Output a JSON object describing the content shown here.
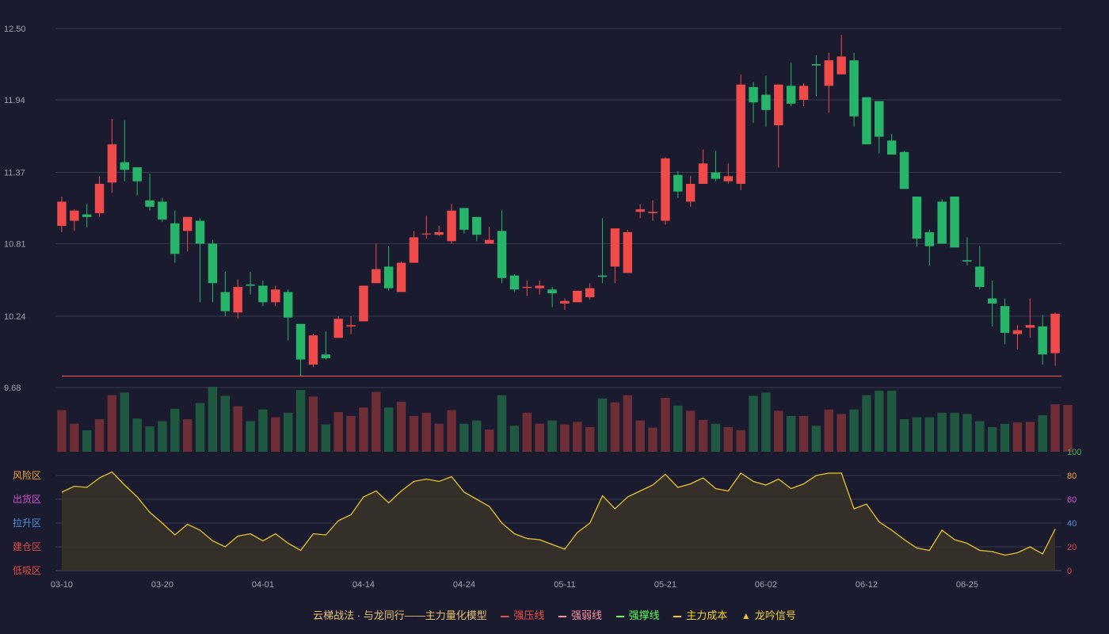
{
  "chart_data": {
    "type": "candlestick",
    "price_axis": {
      "ticks": [
        "12.50",
        "11.94",
        "11.37",
        "10.81",
        "10.24",
        "9.68"
      ],
      "min": 9.68,
      "max": 12.5
    },
    "indicator_axis": {
      "ticks": [
        "100",
        "80",
        "60",
        "40",
        "20",
        "0"
      ],
      "min": 0,
      "max": 100,
      "tick_colors": [
        "#4caf50",
        "#f0a030",
        "#d050d0",
        "#4a90e2",
        "#e04848",
        "#e04848"
      ]
    },
    "zone_labels": [
      {
        "text": "风险区",
        "color": "#f0a030"
      },
      {
        "text": "出货区",
        "color": "#d050d0"
      },
      {
        "text": "拉升区",
        "color": "#4a90e2"
      },
      {
        "text": "建仓区",
        "color": "#e04848"
      },
      {
        "text": "低吸区",
        "color": "#e04848"
      }
    ],
    "x_ticks": [
      {
        "index": 0,
        "label": "03-10"
      },
      {
        "index": 8,
        "label": "03-20"
      },
      {
        "index": 16,
        "label": "04-01"
      },
      {
        "index": 24,
        "label": "04-14"
      },
      {
        "index": 32,
        "label": "04-24"
      },
      {
        "index": 40,
        "label": "05-11"
      },
      {
        "index": 48,
        "label": "05-21"
      },
      {
        "index": 56,
        "label": "06-02"
      },
      {
        "index": 64,
        "label": "06-12"
      },
      {
        "index": 72,
        "label": "06-25"
      }
    ],
    "support_line": 9.77,
    "candles": [
      [
        10.95,
        11.14,
        11.18,
        10.9
      ],
      [
        10.99,
        11.07,
        11.08,
        10.91
      ],
      [
        11.04,
        11.02,
        11.12,
        10.94
      ],
      [
        11.05,
        11.28,
        11.34,
        11.02
      ],
      [
        11.29,
        11.59,
        11.79,
        11.21
      ],
      [
        11.45,
        11.39,
        11.78,
        11.3
      ],
      [
        11.41,
        11.3,
        11.41,
        11.19
      ],
      [
        11.15,
        11.1,
        11.36,
        11.07
      ],
      [
        11.14,
        11.0,
        11.17,
        10.98
      ],
      [
        10.97,
        10.73,
        11.07,
        10.66
      ],
      [
        10.91,
        11.02,
        11.0,
        10.75
      ],
      [
        10.99,
        10.81,
        11.01,
        10.35
      ],
      [
        10.81,
        10.5,
        10.84,
        10.35
      ],
      [
        10.43,
        10.28,
        10.59,
        10.24
      ],
      [
        10.27,
        10.47,
        10.53,
        10.22
      ],
      [
        10.49,
        10.48,
        10.59,
        10.41
      ],
      [
        10.48,
        10.35,
        10.52,
        10.32
      ],
      [
        10.35,
        10.45,
        10.48,
        10.32
      ],
      [
        10.43,
        10.23,
        10.45,
        10.05
      ],
      [
        10.18,
        9.9,
        10.18,
        9.77
      ],
      [
        9.86,
        10.09,
        10.1,
        9.84
      ],
      [
        9.94,
        9.91,
        10.12,
        9.9
      ],
      [
        10.07,
        10.22,
        10.24,
        10.07
      ],
      [
        10.16,
        10.17,
        10.24,
        10.1
      ],
      [
        10.2,
        10.48,
        10.48,
        10.2
      ],
      [
        10.5,
        10.61,
        10.81,
        10.5
      ],
      [
        10.63,
        10.46,
        10.79,
        10.44
      ],
      [
        10.43,
        10.66,
        10.67,
        10.43
      ],
      [
        10.66,
        10.86,
        10.91,
        10.66
      ],
      [
        10.89,
        10.89,
        11.03,
        10.85
      ],
      [
        10.88,
        10.9,
        10.95,
        10.87
      ],
      [
        10.83,
        11.07,
        11.12,
        10.81
      ],
      [
        11.09,
        10.92,
        11.09,
        10.89
      ],
      [
        11.02,
        10.88,
        11.02,
        10.83
      ],
      [
        10.81,
        10.84,
        10.94,
        10.81
      ],
      [
        10.91,
        10.54,
        11.07,
        10.5
      ],
      [
        10.56,
        10.45,
        10.57,
        10.43
      ],
      [
        10.47,
        10.47,
        10.52,
        10.4
      ],
      [
        10.46,
        10.48,
        10.52,
        10.41
      ],
      [
        10.45,
        10.42,
        10.47,
        10.31
      ],
      [
        10.34,
        10.36,
        10.38,
        10.29
      ],
      [
        10.35,
        10.44,
        10.44,
        10.36
      ],
      [
        10.39,
        10.46,
        10.5,
        10.37
      ],
      [
        10.56,
        10.55,
        11.01,
        10.5
      ],
      [
        10.63,
        10.93,
        10.93,
        10.5
      ],
      [
        10.58,
        10.9,
        10.92,
        10.58
      ],
      [
        11.06,
        11.08,
        11.12,
        11.01
      ],
      [
        11.05,
        11.06,
        11.15,
        10.99
      ],
      [
        10.99,
        11.48,
        11.49,
        10.96
      ],
      [
        11.35,
        11.22,
        11.38,
        11.17
      ],
      [
        11.14,
        11.28,
        11.34,
        11.1
      ],
      [
        11.28,
        11.44,
        11.55,
        11.28
      ],
      [
        11.37,
        11.32,
        11.54,
        11.3
      ],
      [
        11.3,
        11.34,
        11.44,
        11.28
      ],
      [
        11.28,
        12.06,
        12.14,
        11.23
      ],
      [
        12.04,
        11.92,
        12.08,
        11.76
      ],
      [
        11.98,
        11.86,
        12.13,
        11.73
      ],
      [
        11.74,
        12.06,
        12.06,
        11.41
      ],
      [
        12.05,
        11.91,
        12.23,
        11.89
      ],
      [
        11.94,
        12.05,
        12.07,
        11.89
      ],
      [
        12.22,
        12.21,
        12.29,
        11.97
      ],
      [
        12.05,
        12.25,
        12.31,
        11.84
      ],
      [
        12.14,
        12.28,
        12.45,
        12.14
      ],
      [
        12.25,
        11.81,
        12.31,
        11.73
      ],
      [
        11.96,
        11.59,
        11.96,
        11.59
      ],
      [
        11.93,
        11.65,
        11.93,
        11.52
      ],
      [
        11.62,
        11.51,
        11.67,
        11.51
      ],
      [
        11.53,
        11.24,
        11.54,
        11.24
      ],
      [
        11.18,
        10.85,
        11.18,
        10.79
      ],
      [
        10.9,
        10.79,
        10.92,
        10.64
      ],
      [
        11.14,
        10.81,
        11.16,
        10.81
      ],
      [
        11.18,
        10.78,
        11.18,
        10.78
      ],
      [
        10.68,
        10.67,
        10.86,
        10.64
      ],
      [
        10.63,
        10.47,
        10.79,
        10.45
      ],
      [
        10.38,
        10.34,
        10.52,
        10.16
      ],
      [
        10.32,
        10.11,
        10.38,
        10.02
      ],
      [
        10.1,
        10.13,
        10.17,
        9.98
      ],
      [
        10.15,
        10.17,
        10.38,
        10.07
      ],
      [
        10.16,
        9.94,
        10.25,
        9.86
      ],
      [
        9.95,
        10.26,
        10.27,
        9.85
      ]
    ],
    "volumes": [
      0.64,
      0.43,
      0.33,
      0.5,
      0.87,
      0.91,
      0.51,
      0.39,
      0.47,
      0.66,
      0.5,
      0.75,
      1.0,
      0.86,
      0.7,
      0.47,
      0.65,
      0.53,
      0.6,
      0.95,
      0.85,
      0.42,
      0.61,
      0.55,
      0.68,
      0.92,
      0.68,
      0.77,
      0.55,
      0.6,
      0.43,
      0.64,
      0.43,
      0.48,
      0.34,
      0.87,
      0.4,
      0.6,
      0.43,
      0.48,
      0.42,
      0.46,
      0.38,
      0.82,
      0.76,
      0.87,
      0.48,
      0.37,
      0.83,
      0.71,
      0.63,
      0.49,
      0.43,
      0.38,
      0.33,
      0.86,
      0.91,
      0.63,
      0.55,
      0.55,
      0.4,
      0.65,
      0.58,
      0.65,
      0.87,
      0.94,
      0.94,
      0.5,
      0.53,
      0.53,
      0.6,
      0.6,
      0.58,
      0.47,
      0.38,
      0.43,
      0.45,
      0.46,
      0.56,
      0.73,
      0.72
    ],
    "indicator": [
      66,
      71,
      70,
      78,
      83,
      72,
      62,
      49,
      40,
      30,
      39,
      34,
      25,
      20,
      29,
      31,
      25,
      31,
      23,
      17,
      31,
      30,
      42,
      47,
      62,
      67,
      57,
      67,
      75,
      77,
      75,
      79,
      66,
      60,
      54,
      40,
      31,
      27,
      26,
      22,
      18,
      32,
      40,
      63,
      52,
      62,
      67,
      72,
      81,
      70,
      73,
      78,
      69,
      67,
      82,
      75,
      72,
      77,
      69,
      73,
      80,
      82,
      82,
      52,
      56,
      41,
      34,
      26,
      19,
      17,
      34,
      26,
      23,
      17,
      16,
      13,
      15,
      20,
      14,
      35
    ]
  },
  "legend": {
    "title": "云梯战法 · 与龙同行——主力量化模型",
    "items": [
      {
        "label": "强压线",
        "color": "#ef4b4b",
        "style": "solid"
      },
      {
        "label": "强弱线",
        "color": "#ff8fa0",
        "style": "dashed"
      },
      {
        "label": "强撑线",
        "color": "#5cff5c",
        "style": "solid"
      },
      {
        "label": "主力成本",
        "color": "#f2d023",
        "style": "dashed"
      },
      {
        "label": "龙吟信号",
        "color": "#f2c040",
        "style": "triangle"
      }
    ]
  },
  "colors": {
    "up": "#ef4b4b",
    "down": "#27b56a",
    "vol_up": "#6e2e36",
    "vol_down": "#1f5a40",
    "line": "#e8c22a",
    "grid": "#363a4e",
    "axis_text": "#9fa3ad"
  }
}
